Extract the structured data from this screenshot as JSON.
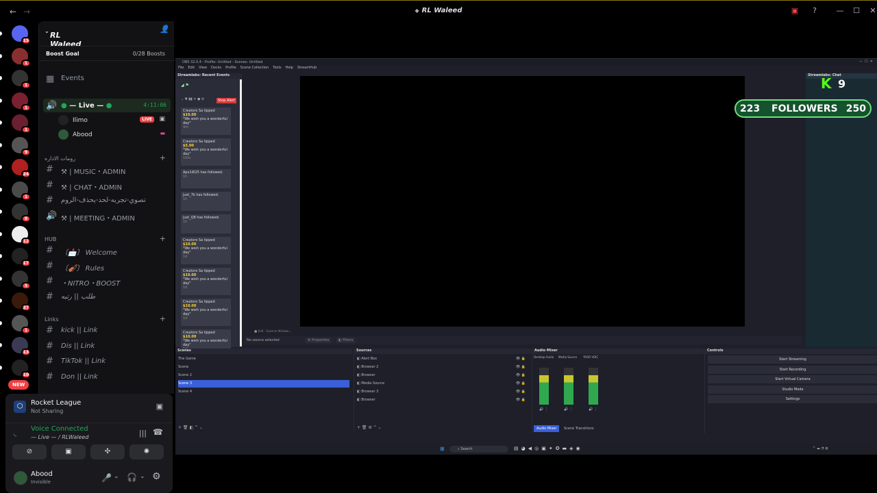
{
  "window": {
    "title": "RL Waleed"
  },
  "server_rail": {
    "servers": [
      {
        "badge": "15"
      },
      {
        "badge": "1"
      },
      {
        "badge": "1"
      },
      {
        "badge": "1"
      },
      {
        "badge": "1"
      },
      {
        "badge": "9"
      },
      {
        "badge": "24"
      },
      {
        "badge": "1"
      },
      {
        "badge": "8"
      },
      {
        "badge": "12"
      },
      {
        "badge": "17"
      },
      {
        "badge": "5"
      },
      {
        "badge": "37"
      },
      {
        "badge": "1"
      },
      {
        "badge": "13"
      },
      {
        "badge": "10"
      }
    ],
    "new_label": "NEW"
  },
  "guild": {
    "name": "RL Waleed",
    "boost_goal": "Boost Goal",
    "boosts": "0/28 Boosts",
    "events": "Events",
    "live_channel": {
      "name": "— Live —",
      "timer": "4:11:06"
    },
    "voice_users": [
      {
        "name": "Ilimo",
        "badge": "LIVE"
      },
      {
        "name": "Abood"
      }
    ],
    "categories": [
      {
        "name": "رومات الاداره",
        "channels": [
          "⚒ | MUSIC・ADMIN",
          "⚒ | CHAT・ADMIN",
          "تصوي-تجربه-لحد-يحذف-الروم",
          "⚒ | MEETING・ADMIN"
        ]
      },
      {
        "name": "HUB",
        "channels": [
          "〔📩〕 Welcome",
          "〔🎻〕 Rules",
          "・NITRO・BOOST",
          "طلب || رتبه"
        ]
      },
      {
        "name": "Links",
        "channels": [
          "kick || Link",
          "Dis || Link",
          "TikTok || Link",
          "Don || Link"
        ]
      }
    ]
  },
  "activity": {
    "game": "Rocket League",
    "status": "Not Sharing"
  },
  "voice": {
    "status": "Voice Connected",
    "channel": "— Live — / RLWaleed"
  },
  "user": {
    "name": "Abood",
    "status": "Invisible"
  },
  "obs": {
    "title": "OBS 32.0.4 - Profile: Untitled - Scenes: Untitled",
    "menus": [
      "File",
      "Edit",
      "View",
      "Docks",
      "Profile",
      "Scene Collection",
      "Tools",
      "Help",
      "StreamHub"
    ],
    "events_title": "Streamlabs: Recent Events",
    "events": [
      {
        "text": "Creators Sa tipped",
        "amount": "$10.00",
        "msg": "\"We wish you a wonderful day\"",
        "time": "9m"
      },
      {
        "text": "Creators Sa tipped",
        "amount": "$5.00",
        "msg": "\"We wish you a wonderful day\"",
        "time": "10m"
      },
      {
        "text": "Apx1iR25 has followed.",
        "amount": "",
        "msg": "",
        "time": "1h"
      },
      {
        "text": "Just_7k has followed.",
        "amount": "",
        "msg": "",
        "time": "1h"
      },
      {
        "text": "Just_Q8 has followed.",
        "amount": "",
        "msg": "",
        "time": "1h"
      },
      {
        "text": "Creators Sa tipped",
        "amount": "$10.00",
        "msg": "\"We wish you a wonderful day\"",
        "time": "1d"
      },
      {
        "text": "Creators Sa tipped",
        "amount": "$10.00",
        "msg": "\"We wish you a wonderful day\"",
        "time": "1d"
      },
      {
        "text": "Creators Sa tipped",
        "amount": "$10.00",
        "msg": "\"We wish you a wonderful day\"",
        "time": "1d"
      },
      {
        "text": "Creators Sa tipped",
        "amount": "$10.00",
        "msg": "\"We wish you a wonderful day\"",
        "time": "1d"
      }
    ],
    "stop_alert": "Stop Alert",
    "no_source": "No source selected",
    "properties": "Properties",
    "filters": "Filters",
    "scenes_title": "Scenes",
    "scenes": [
      "The Game",
      "Scene",
      "Scene 2",
      "Scene 3",
      "Scene 4"
    ],
    "selected_scene": "Scene 3",
    "sources_title": "Sources",
    "sources": [
      "Alert Box",
      "Browser 2",
      "Browser",
      "Media Source",
      "Browser 3",
      "Browser"
    ],
    "mixer_title": "Audio Mixer",
    "mixer_channels": [
      "Desktop Audio",
      "Media Source",
      "YOUR VOIC"
    ],
    "mixer_tabs": [
      "Audio Mixer",
      "Scene Transitions"
    ],
    "controls_title": "Controls",
    "controls": [
      "Start Streaming",
      "Start Recording",
      "Start Virtual Camera",
      "Studio Mode",
      "Settings"
    ],
    "chat_title": "Streamlabs: Chat",
    "taskbar_search": "Search"
  },
  "overlay": {
    "kick_count": "9",
    "followers_current": "223",
    "followers_label": "FOLLOWERS",
    "followers_goal": "250"
  }
}
